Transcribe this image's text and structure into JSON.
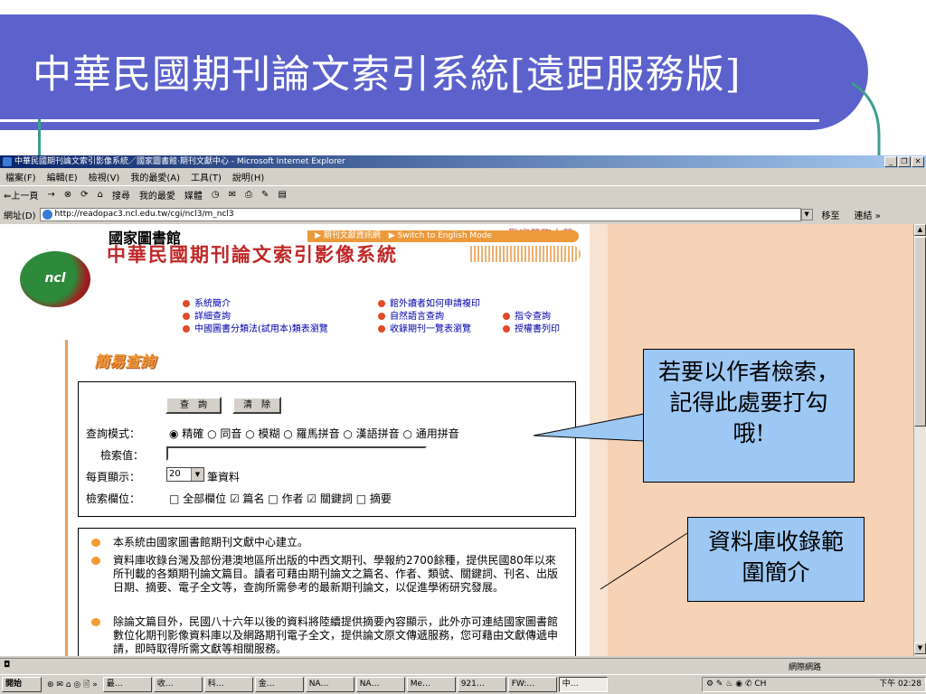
{
  "slide": {
    "title": "中華民國期刊論文索引系統[遠距服務版]"
  },
  "browser": {
    "window_title": "中華民國期刊論文索引影像系統／國家圖書館‧期刊文獻中心 - Microsoft Internet Explorer",
    "menu": [
      "檔案(F)",
      "編輯(E)",
      "檢視(V)",
      "我的最愛(A)",
      "工具(T)",
      "說明(H)"
    ],
    "toolbar": [
      "⇐上一頁",
      "→",
      "⊗",
      "⟳",
      "⌂",
      "搜尋",
      "我的最愛",
      "媒體",
      "◷",
      "✉",
      "⎙",
      "✎",
      "▤"
    ],
    "address_label": "網址(D)",
    "url": "http://readopac3.ncl.edu.tw/cgi/ncl3/m_ncl3",
    "go_label": "移至",
    "links_label": "連結 »",
    "status_zone": "網際網路"
  },
  "page": {
    "welcome": "歡迎蒞臨中華.",
    "library_name": "國家圖書館",
    "top_links": "▶ 期刊文獻資訊網　▶ Switch to English Mode",
    "logo_text": "ncl",
    "system_title": "中華民國期刊論文索引影像系統",
    "nav_links": [
      "系統簡介",
      "詳細查詢",
      "中國圖書分類法(試用本)類表瀏覽",
      "館外讀者如何申請複印",
      "自然語言查詢",
      "收錄期刊一覽表瀏覽",
      "指令查詢",
      "授權書列印"
    ],
    "section_title": "簡易查詢",
    "form": {
      "search_btn": "查　詢",
      "clear_btn": "清　除",
      "mode_label": "查詢模式：",
      "mode_options": "◉ 精確 ○ 同音 ○ 模糊 ○ 羅馬拼音 ○ 漢語拼音 ○ 通用拼音",
      "query_label": "檢索值：",
      "per_page_label": "每頁顯示：",
      "per_page_value": "20",
      "per_page_unit": "筆資料",
      "field_label": "檢索欄位：",
      "field_options": "□ 全部欄位 ☑ 篇名 □ 作者 ☑ 關鍵詞 □ 摘要"
    },
    "info": [
      "本系統由國家圖書館期刊文獻中心建立。",
      "資料庫收錄台灣及部份港澳地區所出版的中西文期刊、學報約2700餘種，提供民國80年以來所刊載的各類期刊論文篇目。讀者可藉由期刊論文之篇名、作者、類號、關鍵詞、刊名、出版日期、摘要、電子全文等，查詢所需參考的最新期刊論文，以促進學術研究發展。",
      "除論文篇目外，民國八十六年以後的資料將陸續提供摘要內容顯示，此外亦可連結國家圖書館數位化期刊影像資料庫以及網路期刊電子全文，提供論文原文傳遞服務，您可藉由文獻傳遞申請，即時取得所需文獻等相關服務。"
    ]
  },
  "callouts": {
    "author_tip": "若要以作者檢索，記得此處要打勾哦!",
    "coverage_tip": "資料庫收錄範圍簡介"
  },
  "taskbar": {
    "start": "開始",
    "quick": "⊛ ✉ ⌂ ◎ 🖹 »",
    "apps": [
      "最…",
      "收…",
      "科…",
      "金…",
      "NA…",
      "NA…",
      "Me…",
      "921…",
      "FW:…",
      "中…"
    ],
    "tray_icons": "⚙ ✎ ♨ ◉ ✆ CH",
    "clock": "下午 02:28"
  }
}
